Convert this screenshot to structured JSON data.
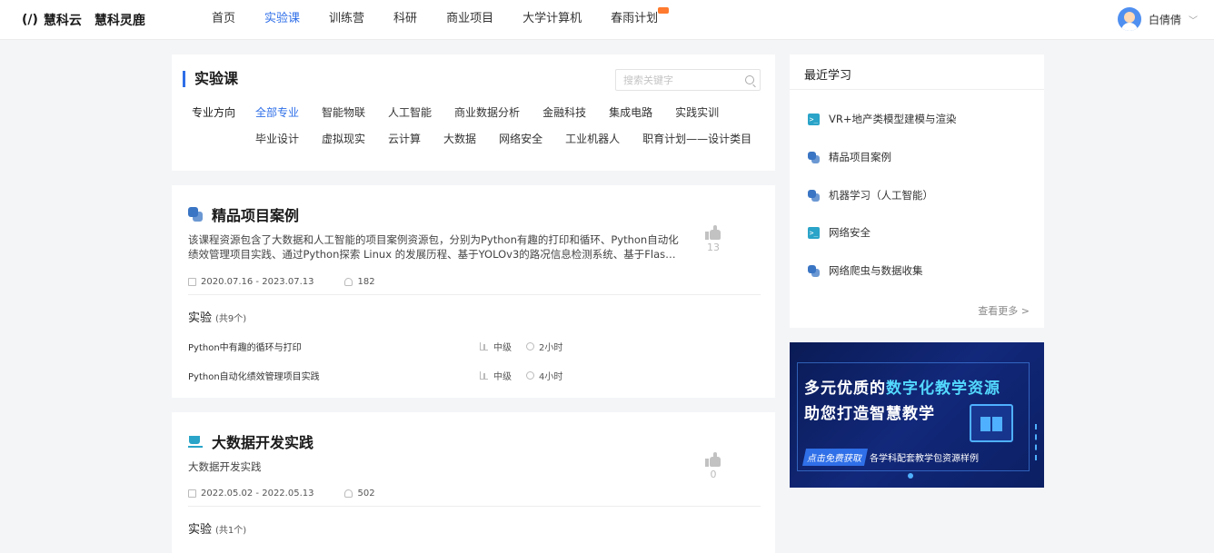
{
  "header": {
    "logo_mark": "(/)",
    "brand1": "慧科云",
    "brand2": "慧科灵鹿",
    "nav": [
      {
        "label": "首页",
        "active": false
      },
      {
        "label": "实验课",
        "active": true
      },
      {
        "label": "训练营",
        "active": false
      },
      {
        "label": "科研",
        "active": false
      },
      {
        "label": "商业项目",
        "active": false
      },
      {
        "label": "大学计算机",
        "active": false
      },
      {
        "label": "春雨计划",
        "active": false,
        "hot_badge": true
      }
    ],
    "user_name": "白倩倩",
    "user_chevron": "﹀"
  },
  "filter": {
    "title": "实验课",
    "search_placeholder": "搜索关键字",
    "search_value": "",
    "label": "专业方向",
    "tags_row1": [
      "全部专业",
      "智能物联",
      "人工智能",
      "商业数据分析",
      "金融科技",
      "集成电路",
      "实践实训"
    ],
    "tags_row2": [
      "毕业设计",
      "虚拟现实",
      "云计算",
      "大数据",
      "网络安全",
      "工业机器人",
      "职育计划——设计类目"
    ],
    "active_tag": "全部专业"
  },
  "courses": [
    {
      "title": "精品项目案例",
      "icon": "python-icon",
      "desc": "该课程资源包含了大数据和人工智能的项目案例资源包，分别为Python有趣的打印和循环、Python自动化绩效管理项目实践、通过Python探索 Linux 的发展历程、基于YOLOv3的路况信息检测系统、基于Flask的国...",
      "date_range": "2020.07.16  -  2023.07.13",
      "learners": "182",
      "likes": "13",
      "exp_label": "实验",
      "exp_count": "(共9个)",
      "experiments": [
        {
          "name": "Python中有趣的循环与打印",
          "level": "中级",
          "duration": "2小时"
        },
        {
          "name": "Python自动化绩效管理项目实践",
          "level": "中级",
          "duration": "4小时"
        }
      ]
    },
    {
      "title": "大数据开发实践",
      "icon": "cup-icon",
      "desc": "大数据开发实践",
      "date_range": "2022.05.02  -  2022.05.13",
      "learners": "502",
      "likes": "0",
      "exp_label": "实验",
      "exp_count": "(共1个)"
    }
  ],
  "recent": {
    "title": "最近学习",
    "items": [
      {
        "label": "VR+地产类模型建模与渲染",
        "icon": "terminal-icon"
      },
      {
        "label": "精品项目案例",
        "icon": "python-icon"
      },
      {
        "label": "机器学习（人工智能）",
        "icon": "python-icon"
      },
      {
        "label": "网络安全",
        "icon": "terminal-icon"
      },
      {
        "label": "网络爬虫与数据收集",
        "icon": "python-icon"
      }
    ],
    "more": "查看更多 >"
  },
  "banner": {
    "line1_prefix": "多元优质的",
    "line1_highlight": "数字化教学资源",
    "line2": "助您打造智慧教学",
    "cta_button": "点击免费获取",
    "cta_text": "各学科配套教学包资源样例",
    "colors": {
      "bg": "#0a1b55",
      "highlight": "#53d9ff",
      "accent": "#2f6fe8"
    }
  },
  "colors": {
    "accent": "#2f6fe8",
    "page_bg": "#f4f5f7"
  }
}
